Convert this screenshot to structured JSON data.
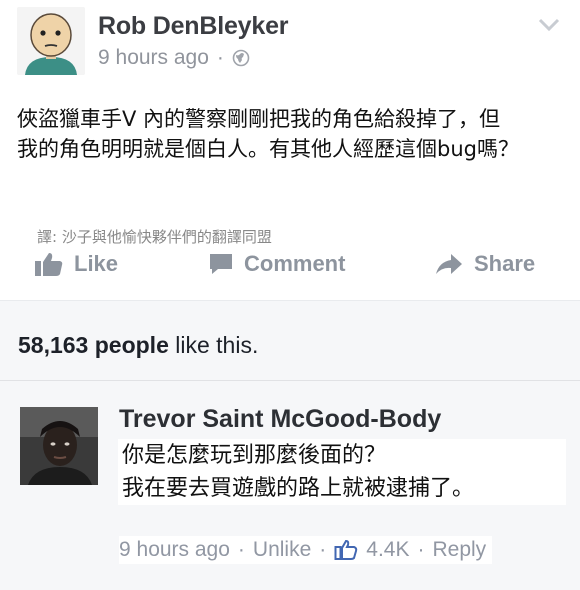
{
  "post": {
    "author": "Rob DenBleyker",
    "time": "9 hours ago",
    "time_separator": "·",
    "text_lines": [
      "俠盜獵車手V 內的警察剛剛把我的角色給殺掉了，但",
      "我的角色明明就是個白人。有其他人經歷這個bug嗎？"
    ],
    "translator_credit": "譯: 沙子與他愉快夥伴們的翻譯同盟",
    "actions": {
      "like": "Like",
      "comment": "Comment",
      "share": "Share"
    }
  },
  "likes": {
    "count": "58,163 people",
    "suffix": " like this."
  },
  "comment": {
    "author": "Trevor Saint McGood-Body",
    "text_lines": [
      "你是怎麼玩到那麼後面的？",
      "我在要去買遊戲的路上就被逮捕了。"
    ],
    "time": "9 hours ago",
    "sep": "·",
    "unlike": "Unlike",
    "like_count": "4.4K",
    "reply": "Reply"
  },
  "icons": {
    "avatar": "cartoon-face-avatar",
    "privacy": "globe-icon",
    "menu": "chevron-down-icon",
    "like": "thumbs-up-icon",
    "comment": "speech-bubble-icon",
    "share": "share-arrow-icon",
    "comment_like": "thumbs-up-blue-icon"
  },
  "colors": {
    "accent": "#4267b2",
    "muted": "#90949c",
    "text": "#1d2129"
  }
}
